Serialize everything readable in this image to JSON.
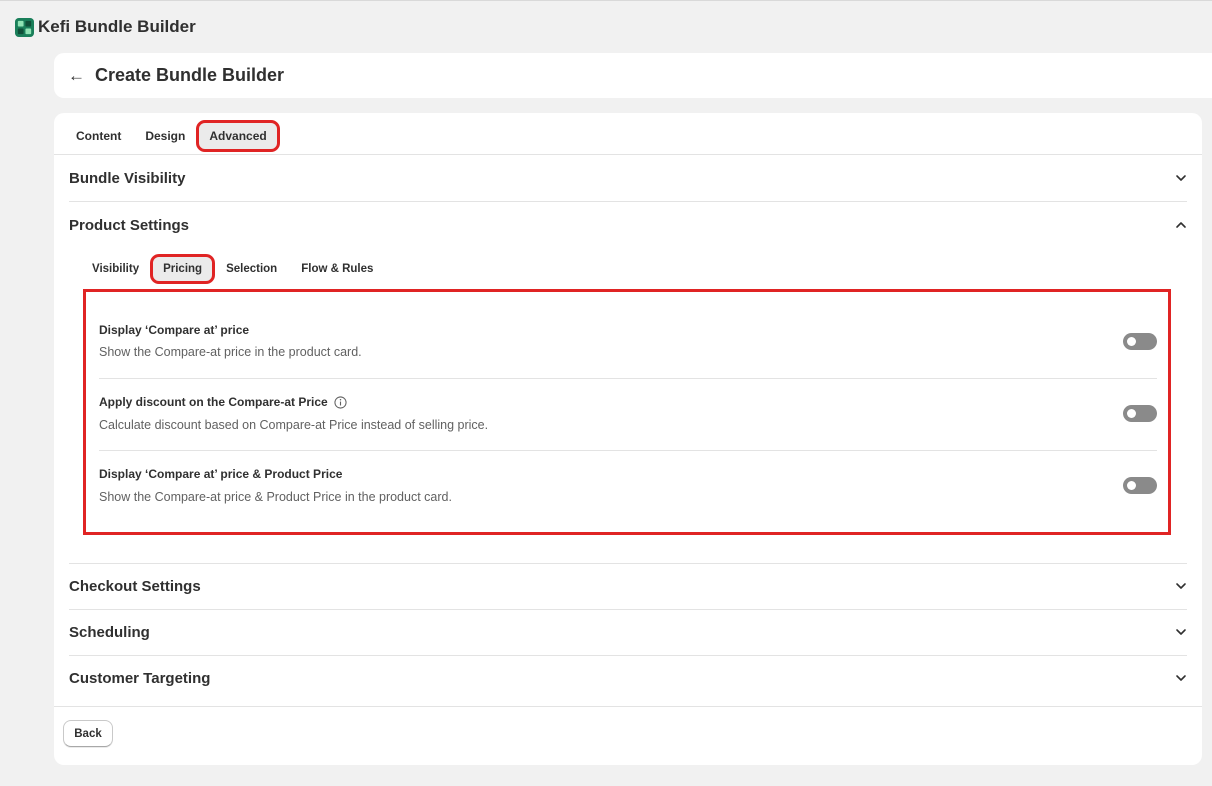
{
  "app": {
    "title": "Kefi Bundle Builder",
    "logo_icon": "kefi-logo-icon"
  },
  "header": {
    "title": "Create Bundle Builder",
    "back_icon": "arrow-left-icon"
  },
  "tabs": [
    {
      "label": "Content",
      "active": false
    },
    {
      "label": "Design",
      "active": false
    },
    {
      "label": "Advanced",
      "active": true
    }
  ],
  "sections": {
    "bundle_visibility": {
      "title": "Bundle Visibility",
      "expanded": false
    },
    "product_settings": {
      "title": "Product Settings",
      "expanded": true
    },
    "checkout_settings": {
      "title": "Checkout Settings",
      "expanded": false
    },
    "scheduling": {
      "title": "Scheduling",
      "expanded": false
    },
    "customer_targeting": {
      "title": "Customer Targeting",
      "expanded": false
    }
  },
  "product_tabs": [
    {
      "label": "Visibility",
      "active": false
    },
    {
      "label": "Pricing",
      "active": true
    },
    {
      "label": "Selection",
      "active": false
    },
    {
      "label": "Flow & Rules",
      "active": false
    }
  ],
  "pricing_settings": [
    {
      "title": "Display ‘Compare at’ price",
      "description": "Show the Compare-at price in the product card.",
      "enabled": false,
      "has_info": false
    },
    {
      "title": "Apply discount on the Compare-at Price",
      "description": "Calculate discount based on Compare-at Price instead of selling price.",
      "enabled": false,
      "has_info": true
    },
    {
      "title": "Display ‘Compare at’ price & Product Price",
      "description": "Show the Compare-at price & Product Price in the product card.",
      "enabled": false,
      "has_info": false
    }
  ],
  "footer": {
    "back_label": "Back"
  },
  "colors": {
    "highlight": "#e02424",
    "toggle_off": "#8a8a8a",
    "background": "#f1f1f1"
  }
}
